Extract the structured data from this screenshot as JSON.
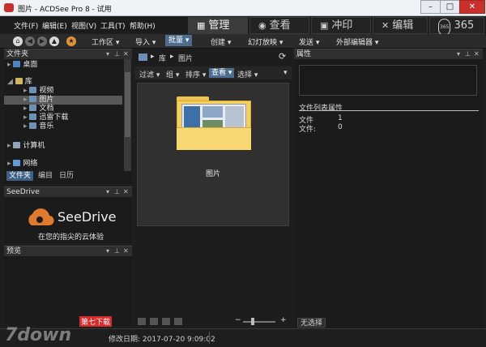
{
  "window": {
    "title": "图片 - ACDSee Pro 8 - 试用"
  },
  "menu": [
    "文件(F)",
    "编辑(E)",
    "视图(V)",
    "工具(T)",
    "帮助(H)"
  ],
  "modes": [
    {
      "label": "管理",
      "icon": "grid-icon",
      "active": true
    },
    {
      "label": "查看",
      "icon": "eye-icon",
      "active": false
    },
    {
      "label": "冲印",
      "icon": "photo-icon",
      "active": false
    },
    {
      "label": "编辑",
      "icon": "tools-icon",
      "active": false
    },
    {
      "label": "365",
      "icon": "365-icon",
      "active": false
    }
  ],
  "toolbar": {
    "workspace": "工作区",
    "import": "导入",
    "batch": "批量",
    "create": "创建",
    "slideshow": "幻灯放映",
    "send": "发送",
    "external_editor": "外部编辑器"
  },
  "folders_panel": {
    "title": "文件夹",
    "items": [
      "桌面",
      "库",
      "视频",
      "图片",
      "文档",
      "迅雷下载",
      "音乐",
      "计算机",
      "网络"
    ],
    "tabs": [
      "文件夹",
      "编目",
      "日历"
    ]
  },
  "seedrive_panel": {
    "title": "SeeDrive",
    "brand": "SeeDrive",
    "tagline": "在您的指尖的云体验"
  },
  "preview_panel": {
    "title": "预览"
  },
  "browser": {
    "path": [
      "库",
      "图片"
    ],
    "filters": [
      "过滤",
      "组",
      "排序",
      "查看",
      "选择"
    ],
    "selected_filter": "查看",
    "thumbnail_label": "图片"
  },
  "properties": {
    "title": "属性",
    "section": "文件列表属性",
    "rows": [
      {
        "label": "文件",
        "value": "1"
      },
      {
        "label": "文件:",
        "value": "0"
      }
    ],
    "bottom_tab": "无选择"
  },
  "status": {
    "modified": "修改日期: 2017-07-20 9:09:02",
    "watermark": "7down",
    "badge": "第七下载"
  },
  "colors": {
    "accent": "#3c5f85",
    "background": "#1e1e1e",
    "folder": "#f1c85a"
  }
}
